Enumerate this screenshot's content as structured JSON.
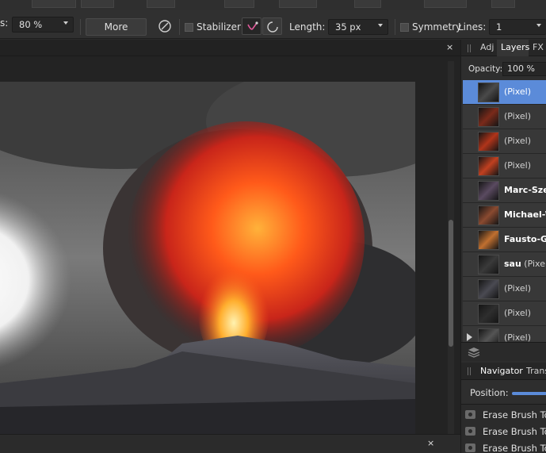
{
  "toolbar": {
    "opacity_suffix_label": "s:",
    "opacity_value": "80 %",
    "more_label": "More",
    "stabilizer_label": "Stabilizer",
    "length_label": "Length:",
    "length_value": "35 px",
    "symmetry_label": "Symmetry",
    "lines_label": "Lines:",
    "lines_value": "1"
  },
  "document": {
    "close_glyph": "×"
  },
  "panel": {
    "tabs": [
      {
        "label": "Adj"
      },
      {
        "label": "Layers"
      },
      {
        "label": "FX"
      }
    ],
    "active_tab": "Layers",
    "opacity_label": "Opacity:",
    "opacity_value": "100 %",
    "layers": [
      {
        "name": "(Pixel)",
        "bold": "",
        "selected": true
      },
      {
        "name": "(Pixel)",
        "bold": ""
      },
      {
        "name": "(Pixel)",
        "bold": ""
      },
      {
        "name": "(Pixel)",
        "bold": ""
      },
      {
        "name": "",
        "bold": "Marc-Sze"
      },
      {
        "name": "",
        "bold": "Michael-W"
      },
      {
        "name": "",
        "bold": "Fausto-Ga"
      },
      {
        "name": " (Pixel)",
        "bold": "sau"
      },
      {
        "name": "(Pixel)",
        "bold": ""
      },
      {
        "name": "(Pixel)",
        "bold": ""
      },
      {
        "name": "(Pixel)",
        "bold": ""
      }
    ],
    "navigator_tabs": [
      {
        "label": "Navigator"
      },
      {
        "label": "Trans"
      }
    ],
    "position_label": "Position:",
    "history": [
      {
        "label": "Erase Brush Tool"
      },
      {
        "label": "Erase Brush Tool"
      },
      {
        "label": "Erase Brush Tool"
      }
    ]
  },
  "colors": {
    "selection": "#5b8bd9",
    "panel_bg": "#2d2d2d",
    "toolbar_bg": "#303030"
  }
}
